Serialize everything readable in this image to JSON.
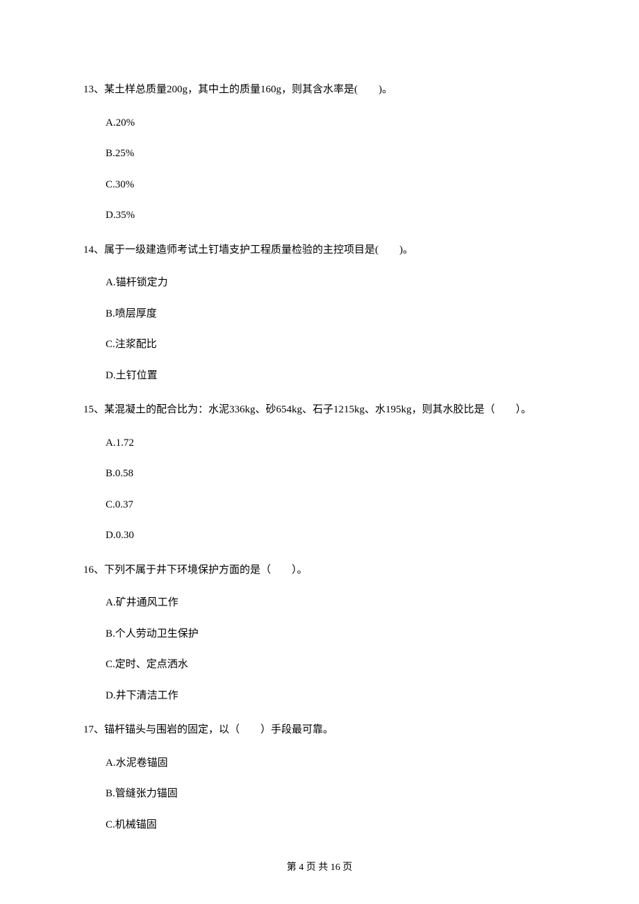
{
  "questions": [
    {
      "stem": "13、某土样总质量200g，其中土的质量160g，则其含水率是(　　)。",
      "options": [
        "A.20%",
        "B.25%",
        "C.30%",
        "D.35%"
      ]
    },
    {
      "stem": "14、属于一级建造师考试土钉墙支护工程质量检验的主控项目是(　　)。",
      "options": [
        "A.锚杆锁定力",
        "B.喷层厚度",
        "C.注浆配比",
        "D.土钉位置"
      ]
    },
    {
      "stem": "15、某混凝土的配合比为：水泥336kg、砂654kg、石子1215kg、水195kg，则其水胶比是（　　）。",
      "options": [
        "A.1.72",
        "B.0.58",
        "C.0.37",
        "D.0.30"
      ]
    },
    {
      "stem": "16、下列不属于井下环境保护方面的是（　　）。",
      "options": [
        "A.矿井通风工作",
        "B.个人劳动卫生保护",
        "C.定时、定点洒水",
        "D.井下清洁工作"
      ]
    },
    {
      "stem": "17、锚杆锚头与围岩的固定，以（　　）手段最可靠。",
      "options": [
        "A.水泥卷锚固",
        "B.管缝张力锚固",
        "C.机械锚固"
      ]
    }
  ],
  "footer": "第 4 页 共 16 页"
}
